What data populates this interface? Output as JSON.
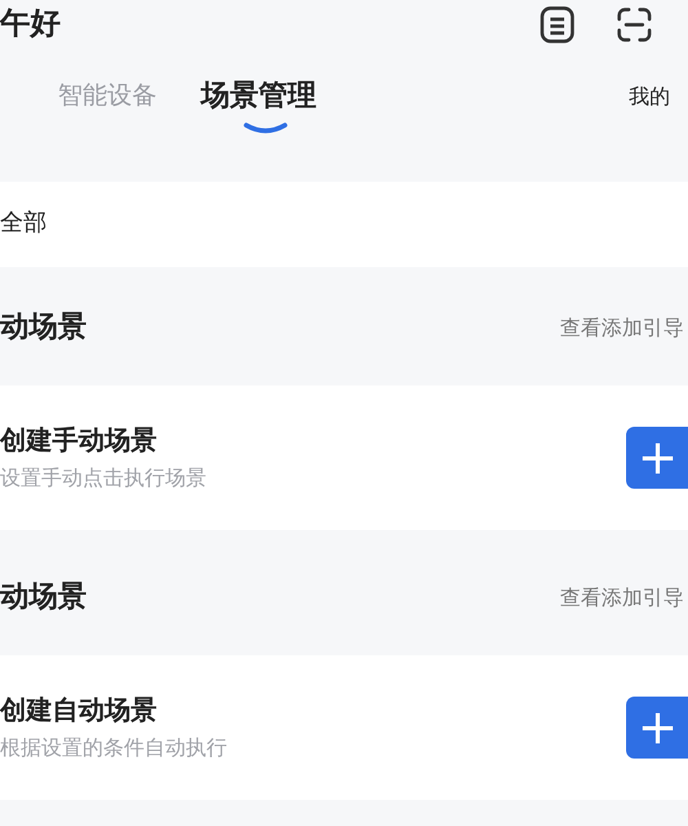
{
  "header": {
    "greeting": "午好"
  },
  "tabs": [
    {
      "label": "智能设备",
      "selected": false
    },
    {
      "label": "场景管理",
      "selected": true
    }
  ],
  "home_selector": "我的",
  "filter": {
    "label": "全部"
  },
  "sections": [
    {
      "title": "动场景",
      "link": "查看添加引导",
      "card": {
        "title": "创建手动场景",
        "subtitle": "设置手动点击执行场景"
      }
    },
    {
      "title": "动场景",
      "link": "查看添加引导",
      "card": {
        "title": "创建自动场景",
        "subtitle": "根据设置的条件自动执行"
      }
    }
  ]
}
